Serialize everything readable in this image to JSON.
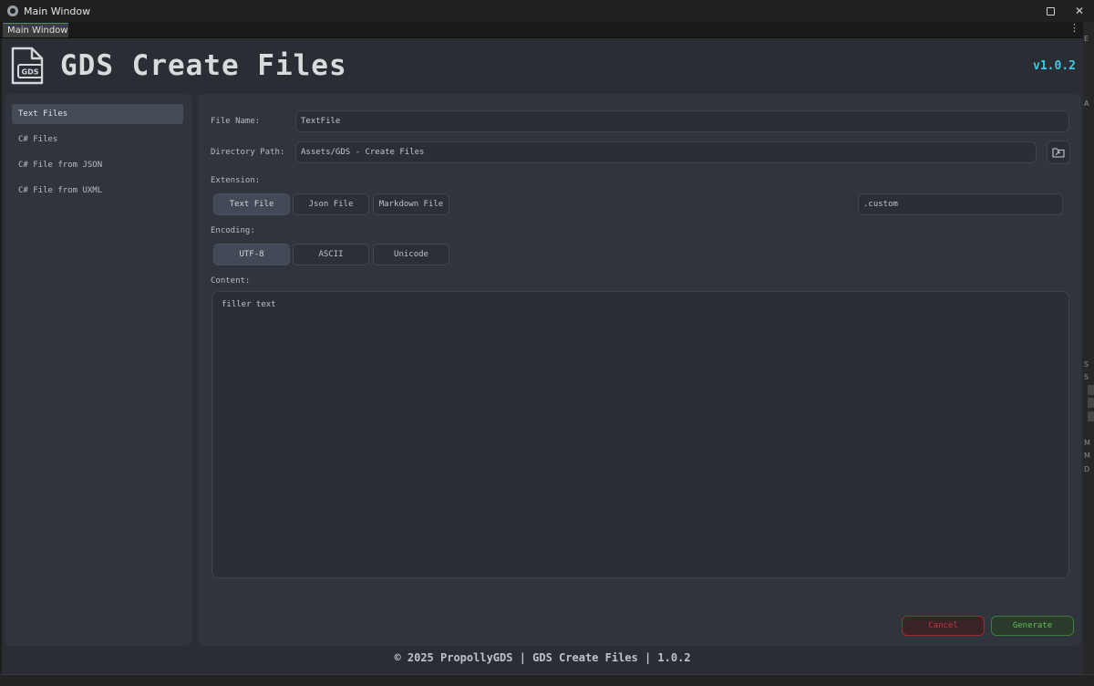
{
  "window": {
    "title": "Main Window",
    "controls": {
      "minimize": "—",
      "close": "✕"
    }
  },
  "tab": {
    "label": "Main Window",
    "menu": "⋮"
  },
  "right_strip": [
    "E",
    "A",
    "S",
    "S",
    "M",
    "M",
    "D"
  ],
  "header": {
    "logo_text": "GDS",
    "title": "GDS Create Files",
    "version": "v1.0.2"
  },
  "sidebar": {
    "items": [
      {
        "label": "Text Files",
        "active": true
      },
      {
        "label": "C# Files",
        "active": false
      },
      {
        "label": "C# File from JSON",
        "active": false
      },
      {
        "label": "C# File from UXML",
        "active": false
      }
    ]
  },
  "form": {
    "file_name": {
      "label": "File Name:",
      "value": "TextFile"
    },
    "directory": {
      "label": "Directory Path:",
      "value": "Assets/GDS - Create Files"
    },
    "extension": {
      "label": "Extension:",
      "options": [
        "Text File",
        "Json File",
        "Markdown File"
      ],
      "selected": "Text File",
      "custom_value": ".custom"
    },
    "encoding": {
      "label": "Encoding:",
      "options": [
        "UTF-8",
        "ASCII",
        "Unicode"
      ],
      "selected": "UTF-8"
    },
    "content": {
      "label": "Content:",
      "value": "filler text"
    }
  },
  "actions": {
    "cancel": "Cancel",
    "generate": "Generate"
  },
  "footer": {
    "text": "© 2025 PropollyGDS | GDS Create Files | 1.0.2"
  },
  "colors": {
    "accent_version": "#3ccce4",
    "cancel": "#c13b3b",
    "generate": "#63bb5a",
    "panel": "#30343c",
    "background": "#2a2d34"
  }
}
